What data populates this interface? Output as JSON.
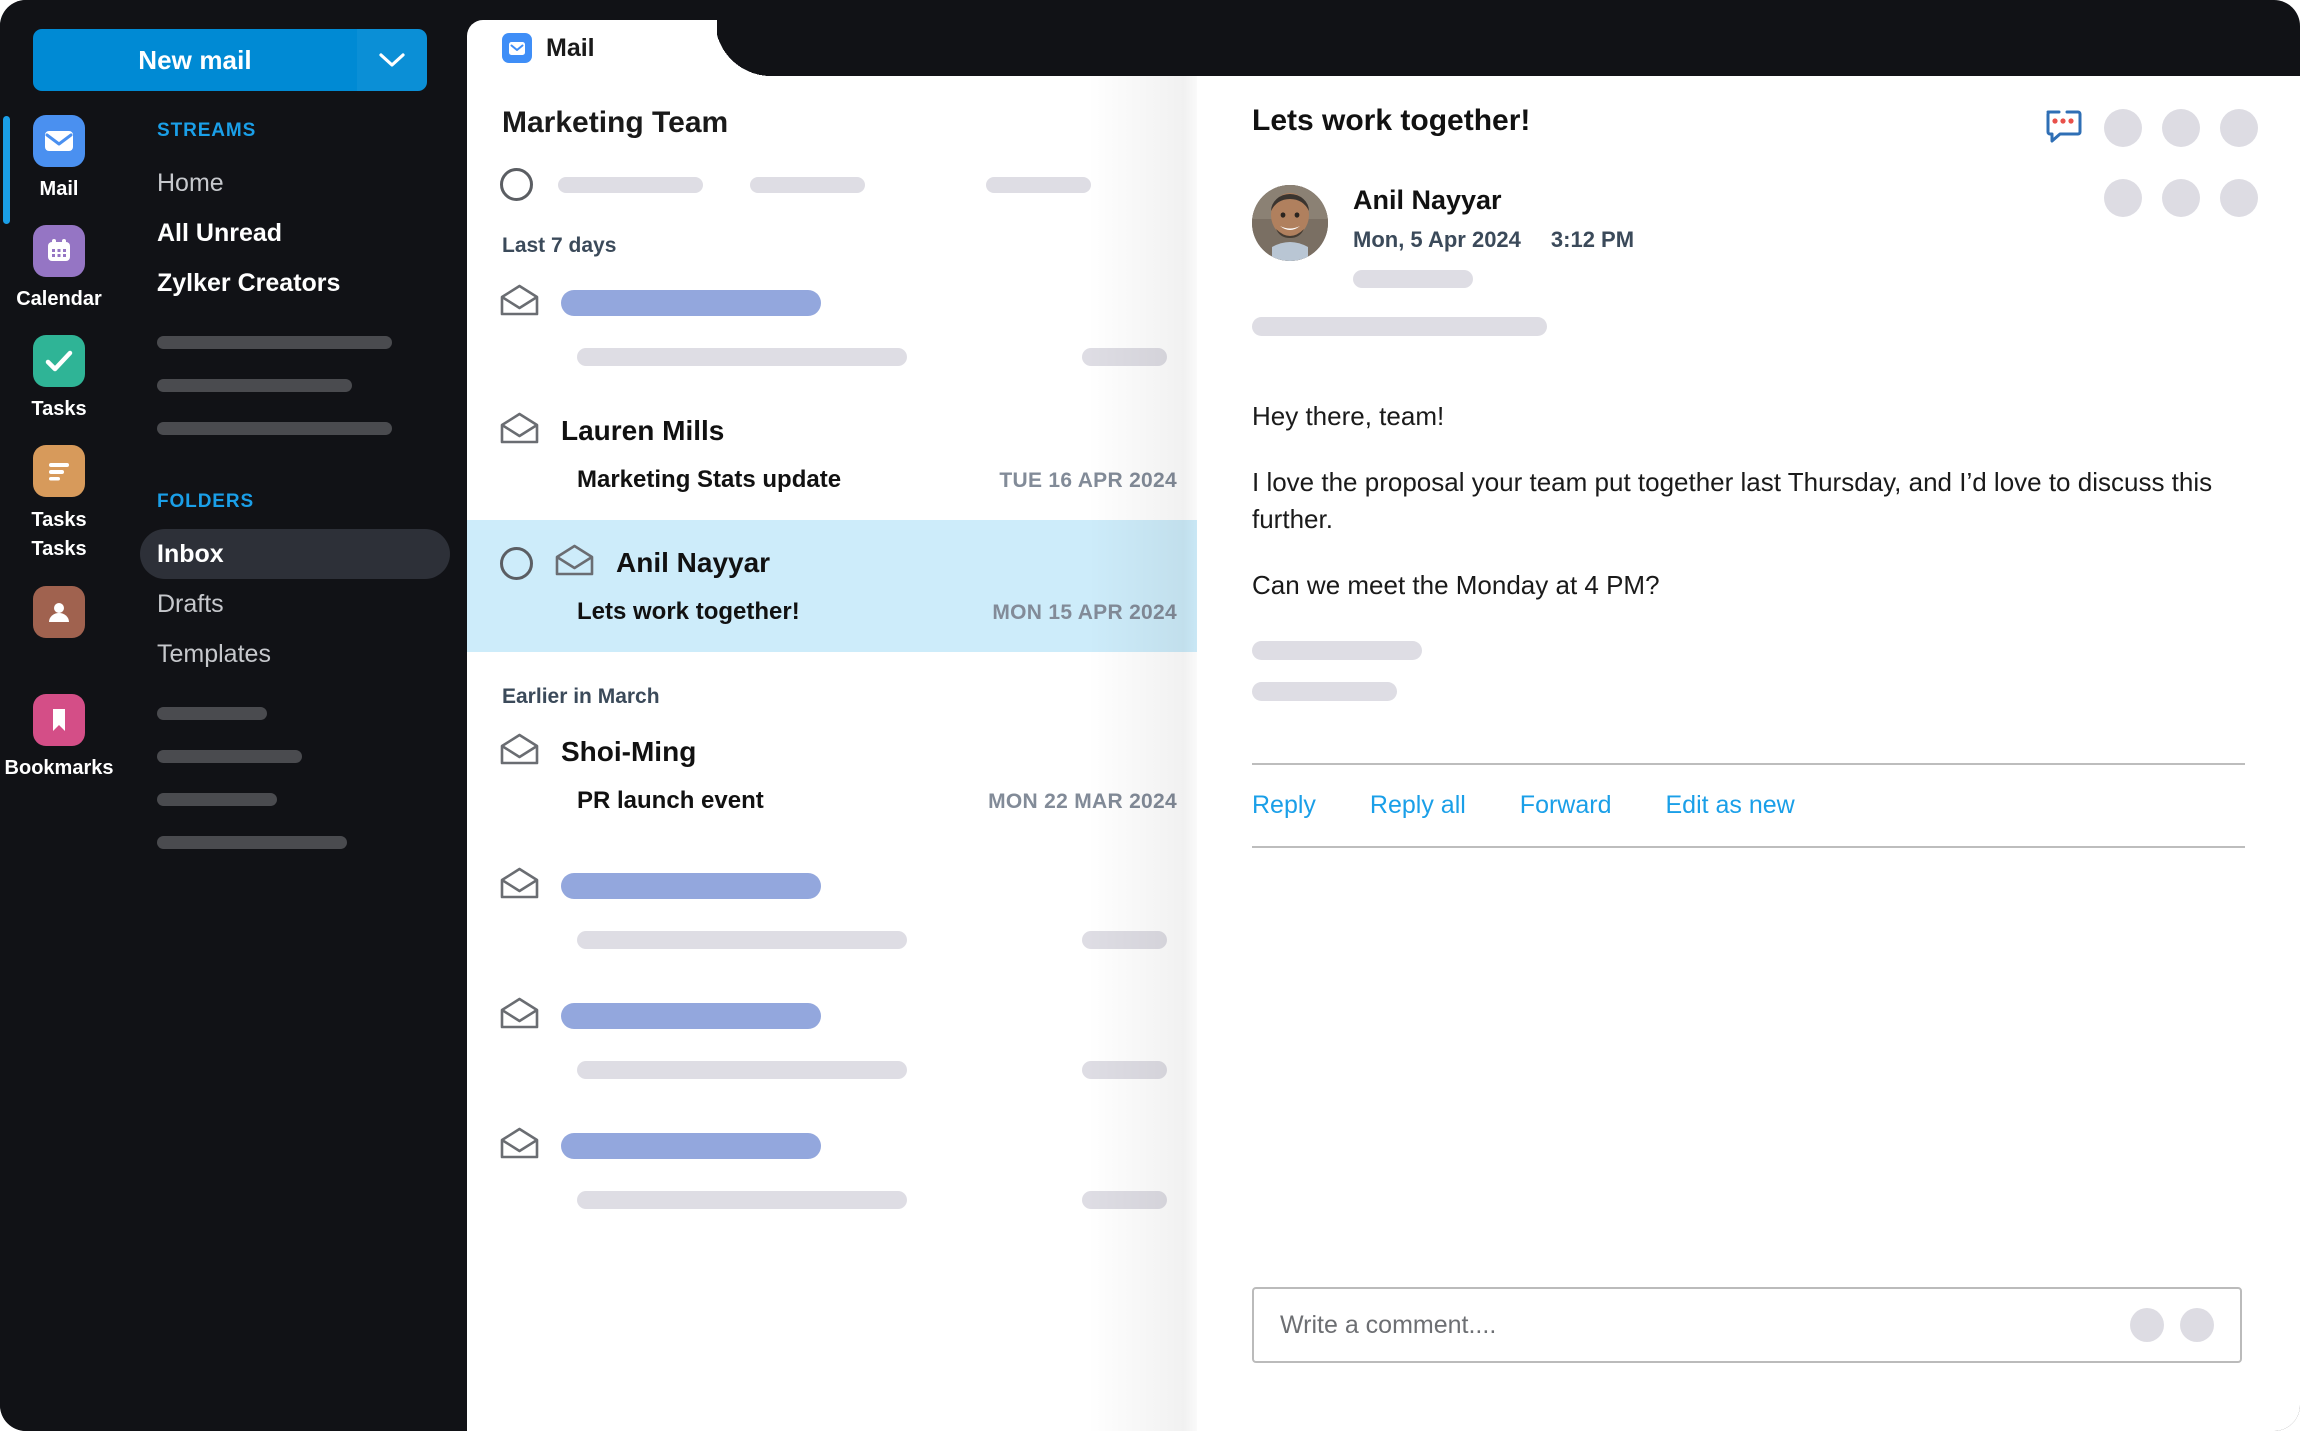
{
  "sidebar": {
    "new_mail_label": "New mail",
    "new_mail_caret_icon": "chevron-down-icon",
    "apps": [
      {
        "label": "Mail",
        "icon": "mail-icon",
        "color": "#4a90f0",
        "active": true
      },
      {
        "label": "Calendar",
        "icon": "calendar-icon",
        "color": "#9575c4",
        "active": false
      },
      {
        "label": "Tasks",
        "icon": "check-icon",
        "color": "#2fb496",
        "active": false
      },
      {
        "label": "Tasks\nTasks",
        "icon": "list-icon",
        "color": "#d79a5b",
        "active": false
      },
      {
        "label": "",
        "icon": "contacts-icon",
        "color": "#a0624f",
        "active": false
      },
      {
        "label": "Bookmarks",
        "icon": "bookmark-icon",
        "color": "#d44e87",
        "active": false
      }
    ],
    "streams_header": "STREAMS",
    "streams": [
      {
        "label": "Home",
        "style": "dim"
      },
      {
        "label": "All Unread",
        "style": "bold"
      },
      {
        "label": "Zylker Creators",
        "style": "bold"
      }
    ],
    "stream_placeholders": [
      235,
      195,
      235
    ],
    "folders_header": "FOLDERS",
    "folders": [
      {
        "label": "Inbox",
        "style": "active"
      },
      {
        "label": "Drafts",
        "style": "dim"
      },
      {
        "label": "Templates",
        "style": "dim"
      }
    ],
    "folder_placeholders": [
      110,
      145,
      120,
      190
    ]
  },
  "tab": {
    "label": "Mail",
    "icon": "mail-icon"
  },
  "maillist": {
    "title": "Marketing Team",
    "thread_header_placeholders": [
      145,
      115,
      105
    ],
    "sections": [
      {
        "label": "Last 7 days",
        "rows": [
          {
            "type": "placeholder"
          },
          {
            "type": "mail",
            "name": "Lauren Mills",
            "subject": "Marketing Stats update",
            "date": "TUE 16 APR 2024",
            "selected": false,
            "has_circle": false
          }
        ]
      },
      {
        "label": "",
        "rows": [
          {
            "type": "mail",
            "name": "Anil Nayyar",
            "subject": "Lets work together!",
            "date": "MON 15 APR 2024",
            "selected": true,
            "has_circle": true
          }
        ]
      },
      {
        "label": "Earlier in March",
        "rows": [
          {
            "type": "mail",
            "name": "Shoi-Ming",
            "subject": "PR launch event",
            "date": "MON 22 MAR 2024",
            "selected": false,
            "has_circle": false
          },
          {
            "type": "placeholder"
          },
          {
            "type": "placeholder"
          },
          {
            "type": "placeholder"
          }
        ]
      }
    ]
  },
  "reader": {
    "subject": "Lets work together!",
    "comment_icon": "comment-bubble-icon",
    "header_buttons": [
      "more-button-1",
      "more-button-2",
      "more-button-3"
    ],
    "secondary_buttons": [
      "more-button-4",
      "more-button-5",
      "more-button-6"
    ],
    "sender_name": "Anil Nayyar",
    "sent_date": "Mon, 5 Apr 2024",
    "sent_time": "3:12 PM",
    "body_paragraphs": [
      "Hey there, team!",
      "I love the proposal your team put together last Thursday, and I’d love to discuss this further.",
      "Can we meet the Monday at 4 PM?"
    ],
    "actions": [
      {
        "label": "Reply"
      },
      {
        "label": "Reply all"
      },
      {
        "label": "Forward"
      },
      {
        "label": "Edit as new"
      }
    ],
    "comment_placeholder": "Write a comment....",
    "comment_value": "",
    "composer_buttons": [
      "attach-button",
      "send-button"
    ]
  },
  "colors": {
    "accent_blue": "#008ad4",
    "link_blue": "#1a9fe8",
    "selected_row": "#cdecfa",
    "sidebar_bg": "#111216",
    "placeholder_gray": "#dedde4",
    "placeholder_blue": "#93a7dd"
  }
}
